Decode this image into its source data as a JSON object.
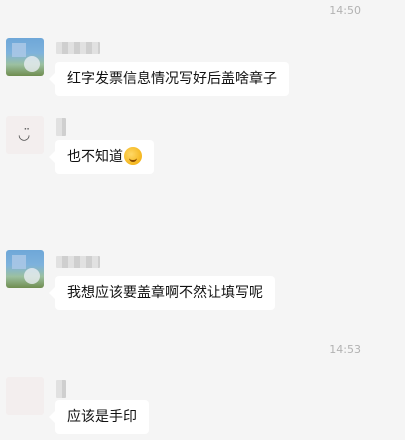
{
  "timestamps": [
    "14:50",
    "14:53"
  ],
  "messages": [
    {
      "text": "红字发票信息情况写好后盖啥章子",
      "avatar": "photo-avatar"
    },
    {
      "text": "也不知道",
      "emoji": "embarrassed-laugh-emoji",
      "avatar": "smile-avatar"
    },
    {
      "text": "我想应该要盖章啊不然让填写呢",
      "avatar": "photo-avatar"
    },
    {
      "text": "应该是手印",
      "avatar": "blank-avatar"
    }
  ]
}
